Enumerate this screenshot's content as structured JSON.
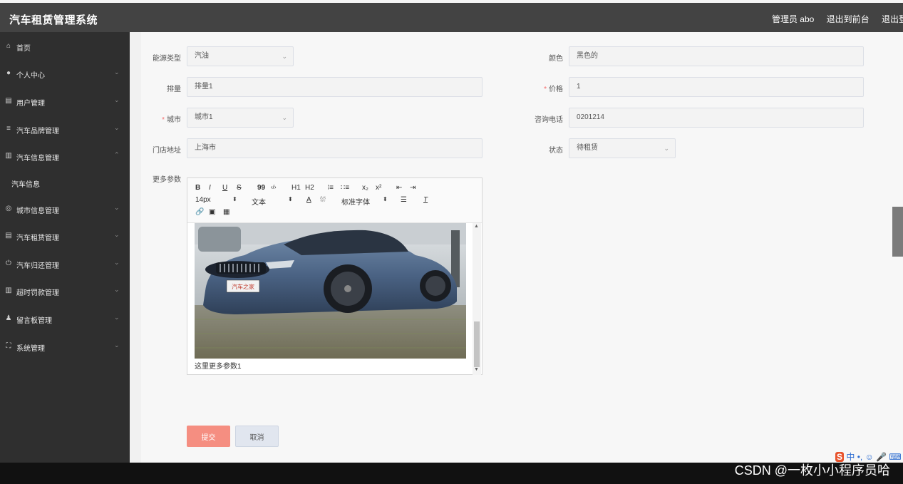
{
  "header": {
    "title": "汽车租赁管理系统",
    "links": [
      "管理员 abo",
      "退出到前台",
      "退出登录"
    ]
  },
  "sidebar": {
    "items": [
      {
        "label": "首页",
        "icon": "home-icon"
      },
      {
        "label": "个人中心",
        "icon": "user-icon"
      },
      {
        "label": "用户管理",
        "icon": "clipboard-icon"
      },
      {
        "label": "汽车品牌管理",
        "icon": "layers-icon"
      },
      {
        "label": "汽车信息管理",
        "icon": "bar-chart-icon"
      },
      {
        "label": "城市信息管理",
        "icon": "compass-icon"
      },
      {
        "label": "汽车租赁管理",
        "icon": "document-icon"
      },
      {
        "label": "汽车归还管理",
        "icon": "power-icon"
      },
      {
        "label": "超时罚款管理",
        "icon": "bars-icon"
      },
      {
        "label": "留言板管理",
        "icon": "user-group-icon"
      },
      {
        "label": "系统管理",
        "icon": "frame-icon"
      }
    ],
    "submenu": {
      "label": "汽车信息"
    }
  },
  "form": {
    "energy_type": {
      "label": "能源类型",
      "value": "汽油"
    },
    "color": {
      "label": "颜色",
      "value": "黑色的"
    },
    "displacement": {
      "label": "排量",
      "value": "排量1"
    },
    "price": {
      "label": "价格",
      "value": "1",
      "required": "*"
    },
    "city": {
      "label": "城市",
      "value": "城市1",
      "required": "*"
    },
    "phone": {
      "label": "咨询电话",
      "value": "0201214"
    },
    "address": {
      "label": "门店地址",
      "value": "上海市"
    },
    "status": {
      "label": "状态",
      "value": "待租赁"
    },
    "more_params": {
      "label": "更多参数"
    }
  },
  "editor": {
    "toolbar_row1": [
      "B",
      "I",
      "U",
      "S",
      "99",
      "‹/›",
      "H1",
      "H2",
      "ol",
      "ul",
      "x₂",
      "x²",
      "indent-left",
      "indent-right"
    ],
    "font_size": "14px",
    "text_style": "文本",
    "font_family": "标准字体",
    "image_badge": "汽车之家",
    "content_text": "这里更多参数1"
  },
  "buttons": {
    "submit": "提交",
    "cancel": "取消"
  },
  "ime": {
    "logo": "S",
    "text": "中 •, ☺ 🎤 ⌨"
  },
  "watermark": "CSDN @一枚小小程序员哈",
  "colors": {
    "header": "#434343",
    "sidebar": "#2f2f2f",
    "submit": "#f58e81",
    "cancel": "#e1e6ef",
    "required": "#f56c6c"
  }
}
